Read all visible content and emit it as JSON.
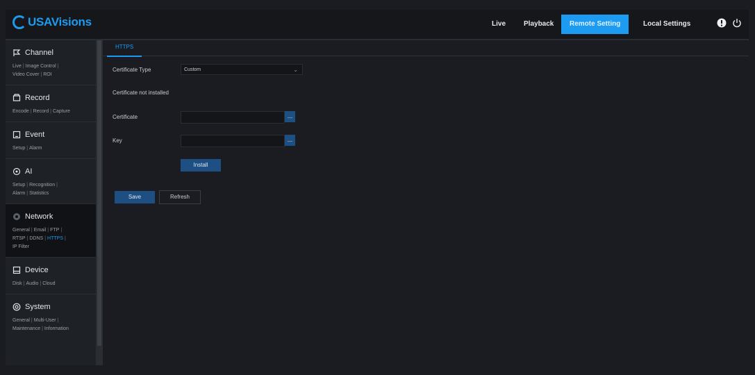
{
  "app": {
    "logo_text": "USAVisions"
  },
  "topnav": {
    "items": [
      {
        "label": "Live"
      },
      {
        "label": "Playback"
      },
      {
        "label": "Remote Setting"
      },
      {
        "label": "Local Settings"
      }
    ],
    "active_index": 2
  },
  "sidebar": {
    "sections": [
      {
        "title": "Channel",
        "icon": "channel-icon",
        "links": [
          "Live",
          "Image Control",
          "Video Cover",
          "ROI"
        ]
      },
      {
        "title": "Record",
        "icon": "record-icon",
        "links": [
          "Encode",
          "Record",
          "Capture"
        ]
      },
      {
        "title": "Event",
        "icon": "event-icon",
        "links": [
          "Setup",
          "Alarm"
        ]
      },
      {
        "title": "AI",
        "icon": "ai-icon",
        "links": [
          "Setup",
          "Recognition",
          "Alarm",
          "Statistics"
        ]
      },
      {
        "title": "Network",
        "icon": "network-icon",
        "links": [
          "General",
          "Email",
          "FTP",
          "RTSP",
          "DDNS",
          "HTTPS",
          "IP Filter"
        ],
        "current_link": "HTTPS"
      },
      {
        "title": "Device",
        "icon": "device-icon",
        "links": [
          "Disk",
          "Audio",
          "Cloud"
        ]
      },
      {
        "title": "System",
        "icon": "system-icon",
        "links": [
          "General",
          "Multi-User",
          "Maintenance",
          "Information"
        ]
      }
    ]
  },
  "content": {
    "tab": "HTTPS",
    "certificate_type_label": "Certificate Type",
    "certificate_type_value": "Custom",
    "status_text": "Certificate not installed",
    "certificate_label": "Certificate",
    "certificate_value": "",
    "key_label": "Key",
    "key_value": "",
    "browse_label": "...",
    "install_label": "Install",
    "save_label": "Save",
    "refresh_label": "Refresh"
  },
  "colors": {
    "accent": "#1d9bf0",
    "button": "#1d4f82",
    "background": "#1a1c21"
  }
}
